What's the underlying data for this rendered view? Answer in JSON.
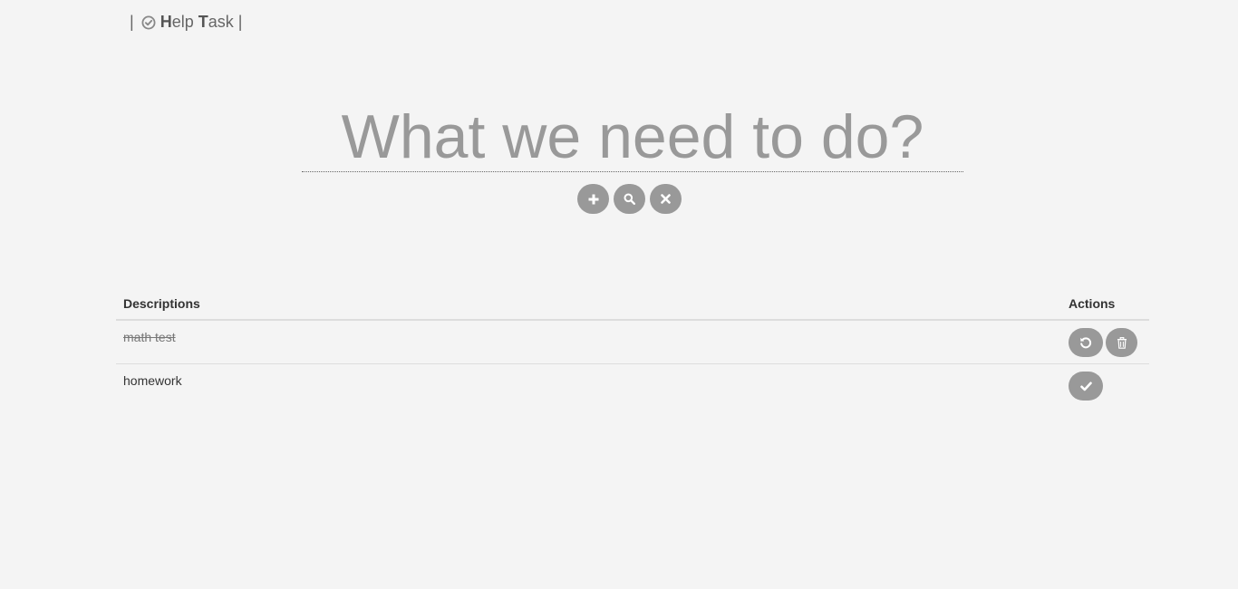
{
  "brand": {
    "pipe_left": "|",
    "pipe_right": "|",
    "icon": "check-circle-icon",
    "name_h": "H",
    "name_elp": "elp ",
    "name_t": "T",
    "name_ask": "ask"
  },
  "task_input": {
    "placeholder": "What we need to do?",
    "value": ""
  },
  "controls": [
    {
      "name": "add-button",
      "icon": "plus-icon"
    },
    {
      "name": "search-button",
      "icon": "search-icon"
    },
    {
      "name": "clear-button",
      "icon": "close-icon"
    }
  ],
  "table": {
    "headers": {
      "descriptions": "Descriptions",
      "actions": "Actions"
    },
    "rows": [
      {
        "description": "math test",
        "completed": true,
        "actions": [
          "undo-icon",
          "trash-icon"
        ]
      },
      {
        "description": "homework",
        "completed": false,
        "actions": [
          "check-icon"
        ]
      }
    ]
  },
  "colors": {
    "background": "#f4f4f4",
    "button": "#999999",
    "text": "#333333",
    "muted": "#999999"
  }
}
